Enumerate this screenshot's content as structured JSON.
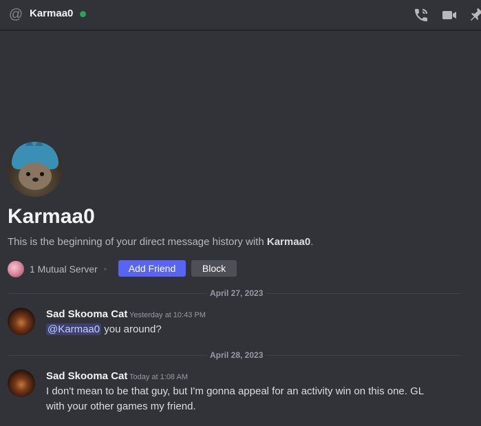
{
  "header": {
    "title": "Karmaa0",
    "status_color": "#23a55a",
    "icons": [
      "at-icon",
      "voice-call-icon",
      "video-call-icon",
      "pin-icon"
    ]
  },
  "profile": {
    "name": "Karmaa0",
    "intro_prefix": "This is the beginning of your direct message history with ",
    "intro_name": "Karmaa0",
    "intro_suffix": ".",
    "mutual_servers": "1 Mutual Server",
    "add_friend_label": "Add Friend",
    "block_label": "Block"
  },
  "messages": [
    {
      "date_divider": "April 27, 2023",
      "author": "Sad Skooma Cat",
      "timestamp": "Yesterday at 10:43 PM",
      "mention": "@Karmaa0",
      "text": " you around?"
    },
    {
      "date_divider": "April 28, 2023",
      "author": "Sad Skooma Cat",
      "timestamp": "Today at 1:08 AM",
      "text": "I don't mean to be that guy, but I'm gonna appeal for an activity win on this one. GL with your other games my friend."
    }
  ],
  "colors": {
    "background": "#313338",
    "accent": "#5865f2",
    "secondary_button": "#4e5058",
    "online": "#23a55a"
  }
}
